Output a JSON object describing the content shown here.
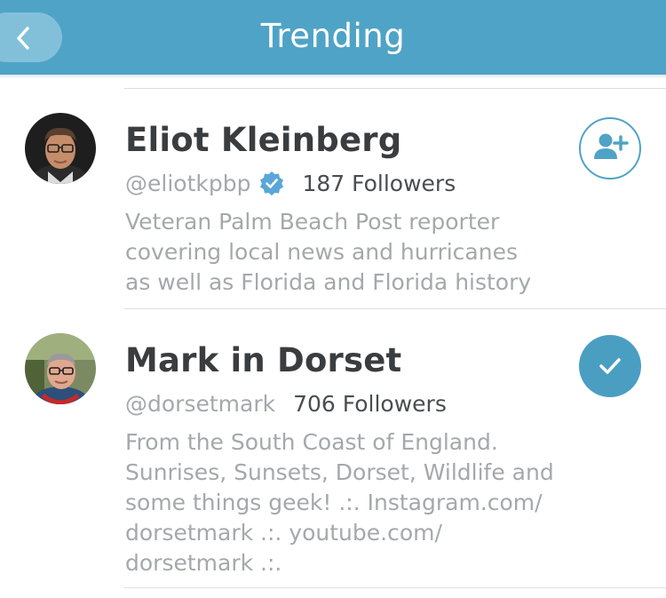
{
  "header": {
    "title": "Trending",
    "back_icon": "chevron-left-icon"
  },
  "users": [
    {
      "name": "Eliot Kleinberg",
      "handle": "@eliotkpbp",
      "verified": true,
      "followers": "187 Followers",
      "bio": "Veteran Palm Beach Post reporter\ncovering local news and hurricanes\nas well as Florida and Florida history",
      "action": "follow",
      "action_icon": "add-user-icon"
    },
    {
      "name": "Mark in Dorset",
      "handle": "@dorsetmark",
      "verified": false,
      "followers": "706 Followers",
      "bio": "From the South Coast of England.\nSunrises, Sunsets, Dorset, Wildlife and\nsome things geek! .:.  Instagram.com/\ndorsetmark .:. youtube.com/\ndorsetmark .:.",
      "action": "following",
      "action_icon": "checkmark-icon"
    }
  ],
  "colors": {
    "header_bg": "#4fa3c6",
    "accent": "#4a9ec2",
    "verified": "#5aa6d8",
    "muted_text": "#a5a8ab",
    "name_text": "#3a3d40"
  }
}
